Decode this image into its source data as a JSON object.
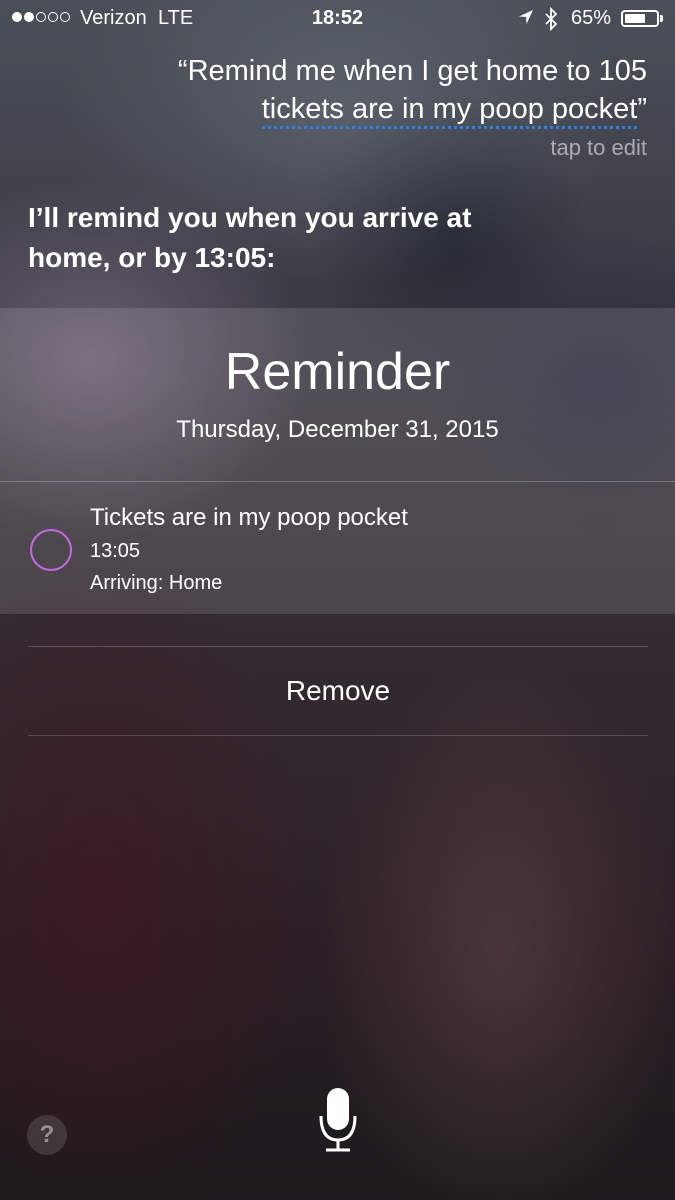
{
  "status_bar": {
    "carrier": "Verizon",
    "network": "LTE",
    "time": "18:52",
    "battery_percent": "65%",
    "battery_level": 0.65,
    "signal_bars_filled": 2,
    "signal_bars_total": 5
  },
  "siri": {
    "query_line1": "“Remind me when I get home to 105",
    "query_line2": "tickets are in my poop pocket",
    "query_close": "”",
    "tap_to_edit": "tap to edit",
    "response_line1": "I’ll remind you when you arrive at",
    "response_line2": "home, or by 13:05:"
  },
  "reminder_card": {
    "title": "Reminder",
    "date": "Thursday, December 31, 2015",
    "item": {
      "title": "Tickets are in my poop pocket",
      "time": "13:05",
      "location": "Arriving: Home"
    },
    "accent_color": "#c46ae0"
  },
  "actions": {
    "remove_label": "Remove"
  },
  "bottom": {
    "help_label": "?",
    "mic_icon": "microphone-icon"
  },
  "colors": {
    "dictation_underline": "#2e7fe6"
  }
}
